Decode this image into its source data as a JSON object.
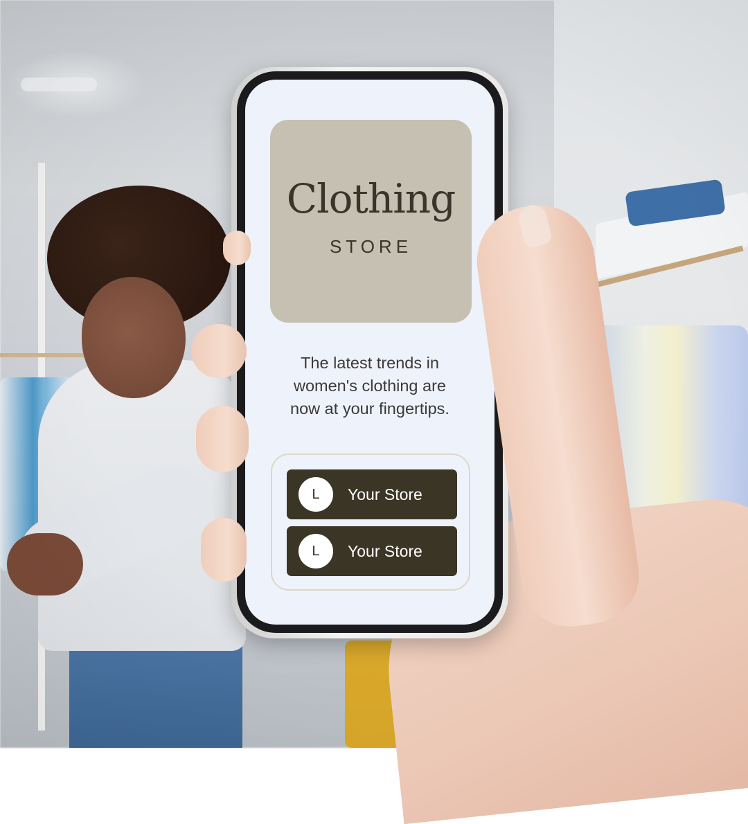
{
  "logo": {
    "title": "Clothing",
    "subtitle": "STORE"
  },
  "tagline": {
    "line1": "The latest trends in",
    "line2": "women's clothing are",
    "line3": "now at your fingertips."
  },
  "links": [
    {
      "icon_letter": "L",
      "label": "Your Store"
    },
    {
      "icon_letter": "L",
      "label": "Your Store"
    }
  ],
  "colors": {
    "screen_background": "#eef2fb",
    "logo_card": "#c6c0b3",
    "button": "#3b3526",
    "button_text": "#ffffff",
    "box_border": "#ddd7c7"
  }
}
